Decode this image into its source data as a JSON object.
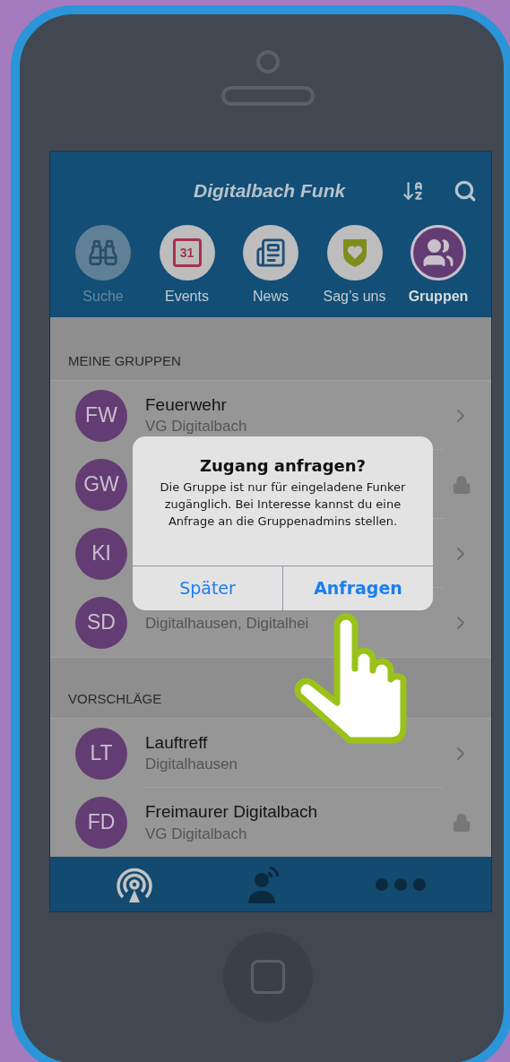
{
  "app_title": "Digitalbach Funk",
  "tabs": [
    {
      "label": "Suche",
      "selected": false,
      "disabled": true
    },
    {
      "label": "Events",
      "selected": false,
      "disabled": false,
      "icon_text": "31"
    },
    {
      "label": "News",
      "selected": false,
      "disabled": false
    },
    {
      "label": "Sag’s uns",
      "selected": false,
      "disabled": false
    },
    {
      "label": "Gruppen",
      "selected": true,
      "disabled": false
    }
  ],
  "sections": [
    {
      "title": "MEINE GRUPPEN",
      "groups": [
        {
          "initials": "FW",
          "name": "Feuerwehr",
          "location": "VG Digitalbach",
          "locked": false
        },
        {
          "initials": "GW",
          "locked": true
        },
        {
          "initials": "KI",
          "locked": false
        },
        {
          "initials": "SD",
          "location": "Digitalhausen, Digitalhei",
          "locked": false
        }
      ]
    },
    {
      "title": "VORSCHLÄGE",
      "groups": [
        {
          "initials": "LT",
          "name": "Lauftreff",
          "location": "Digitalhausen",
          "locked": false
        },
        {
          "initials": "FD",
          "name": "Freimaurer Digitalbach",
          "location": "VG Digitalbach",
          "locked": true
        }
      ]
    }
  ],
  "dialog": {
    "title": "Zugang anfragen?",
    "message": "Die Gruppe ist nur für eingeladene Funker zugänglich. Bei Interesse kannst du eine Anfrage an die Gruppenadmins stellen.",
    "buttons": [
      {
        "label": "Später",
        "emphasized": false
      },
      {
        "label": "Anfragen",
        "emphasized": true
      }
    ]
  }
}
